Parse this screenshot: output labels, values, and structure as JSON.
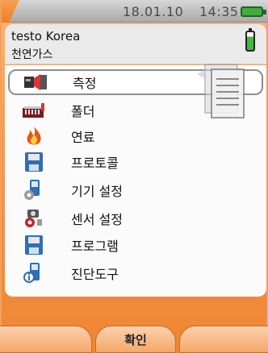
{
  "status_bar": {
    "date": "18.01.10",
    "time": "14:35"
  },
  "header": {
    "title": "testo Korea",
    "subtitle": "천연가스"
  },
  "menu": {
    "items": [
      {
        "label": "측정",
        "icon": "measure-icon",
        "selected": true
      },
      {
        "label": "폴더",
        "icon": "folder-icon",
        "selected": false
      },
      {
        "label": "연료",
        "icon": "flame-icon",
        "selected": false
      },
      {
        "label": "프로토콜",
        "icon": "floppy-disk-icon",
        "selected": false
      },
      {
        "label": "기기 설정",
        "icon": "device-settings-icon",
        "selected": false
      },
      {
        "label": "센서 설정",
        "icon": "sensor-settings-icon",
        "selected": false
      },
      {
        "label": "프로그램",
        "icon": "program-floppy-icon",
        "selected": false
      },
      {
        "label": "진단도구",
        "icon": "diagnostics-icon",
        "selected": false
      }
    ]
  },
  "softkeys": {
    "left": "",
    "center": "확인",
    "right": ""
  },
  "colors": {
    "accent": "#ef8533",
    "panel": "#fbfbfb",
    "battery": "#3dbb3d"
  }
}
